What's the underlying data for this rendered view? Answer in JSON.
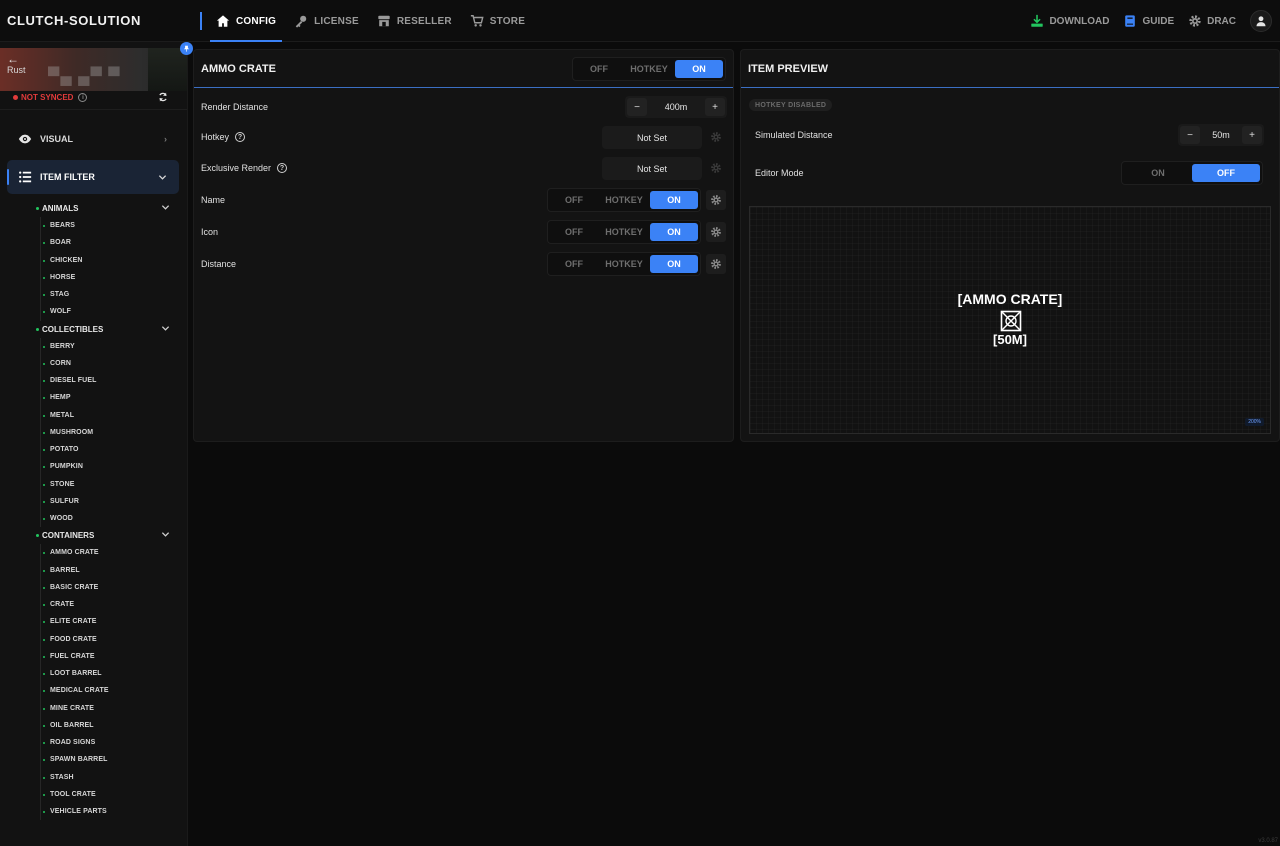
{
  "brand": "CLUTCH-SOLUTION",
  "nav": [
    {
      "label": "CONFIG",
      "icon": "home-icon",
      "active": true
    },
    {
      "label": "LICENSE",
      "icon": "key-icon"
    },
    {
      "label": "RESELLER",
      "icon": "store-icon"
    },
    {
      "label": "STORE",
      "icon": "cart-icon"
    }
  ],
  "nav_right": {
    "download": "DOWNLOAD",
    "guide": "GUIDE",
    "user": "DRAC"
  },
  "sidebar": {
    "game": "Rust",
    "sync_status": "NOT SYNCED",
    "menu": {
      "visual": "VISUAL",
      "item_filter": "ITEM FILTER"
    },
    "categories": [
      {
        "name": "ANIMALS",
        "items": [
          "BEARS",
          "BOAR",
          "CHICKEN",
          "HORSE",
          "STAG",
          "WOLF"
        ]
      },
      {
        "name": "COLLECTIBLES",
        "items": [
          "BERRY",
          "CORN",
          "DIESEL FUEL",
          "HEMP",
          "METAL",
          "MUSHROOM",
          "POTATO",
          "PUMPKIN",
          "STONE",
          "SULFUR",
          "WOOD"
        ]
      },
      {
        "name": "CONTAINERS",
        "items": [
          "AMMO CRATE",
          "BARREL",
          "BASIC CRATE",
          "CRATE",
          "ELITE CRATE",
          "FOOD CRATE",
          "FUEL CRATE",
          "LOOT BARREL",
          "MEDICAL CRATE",
          "MINE CRATE",
          "OIL BARREL",
          "ROAD SIGNS",
          "SPAWN BARREL",
          "STASH",
          "TOOL CRATE",
          "VEHICLE PARTS"
        ]
      }
    ]
  },
  "config": {
    "title": "AMMO CRATE",
    "toggle": {
      "off": "OFF",
      "hotkey": "HOTKEY",
      "on": "ON",
      "selected": "ON"
    },
    "render_distance": {
      "label": "Render Distance",
      "value": "400m",
      "minus": "−",
      "plus": "+"
    },
    "hotkey": {
      "label": "Hotkey",
      "value": "Not Set"
    },
    "exclusive_render": {
      "label": "Exclusive Render",
      "value": "Not Set"
    },
    "name": {
      "label": "Name",
      "off": "OFF",
      "hotkey": "HOTKEY",
      "on": "ON"
    },
    "icon": {
      "label": "Icon",
      "off": "OFF",
      "hotkey": "HOTKEY",
      "on": "ON"
    },
    "distance": {
      "label": "Distance",
      "off": "OFF",
      "hotkey": "HOTKEY",
      "on": "ON"
    }
  },
  "preview": {
    "title": "ITEM PREVIEW",
    "hotkey_badge": "HOTKEY DISABLED",
    "simulated_distance": {
      "label": "Simulated Distance",
      "value": "50m",
      "minus": "−",
      "plus": "+"
    },
    "editor_mode": {
      "label": "Editor Mode",
      "on": "ON",
      "off": "OFF",
      "selected": "OFF"
    },
    "render_name": "[AMMO CRATE]",
    "render_distance": "[50M]",
    "zoom": "200%"
  },
  "version": "v3.0.87",
  "colors": {
    "accent": "#3b82f6",
    "danger": "#e23b3b",
    "success": "#22c55e"
  }
}
